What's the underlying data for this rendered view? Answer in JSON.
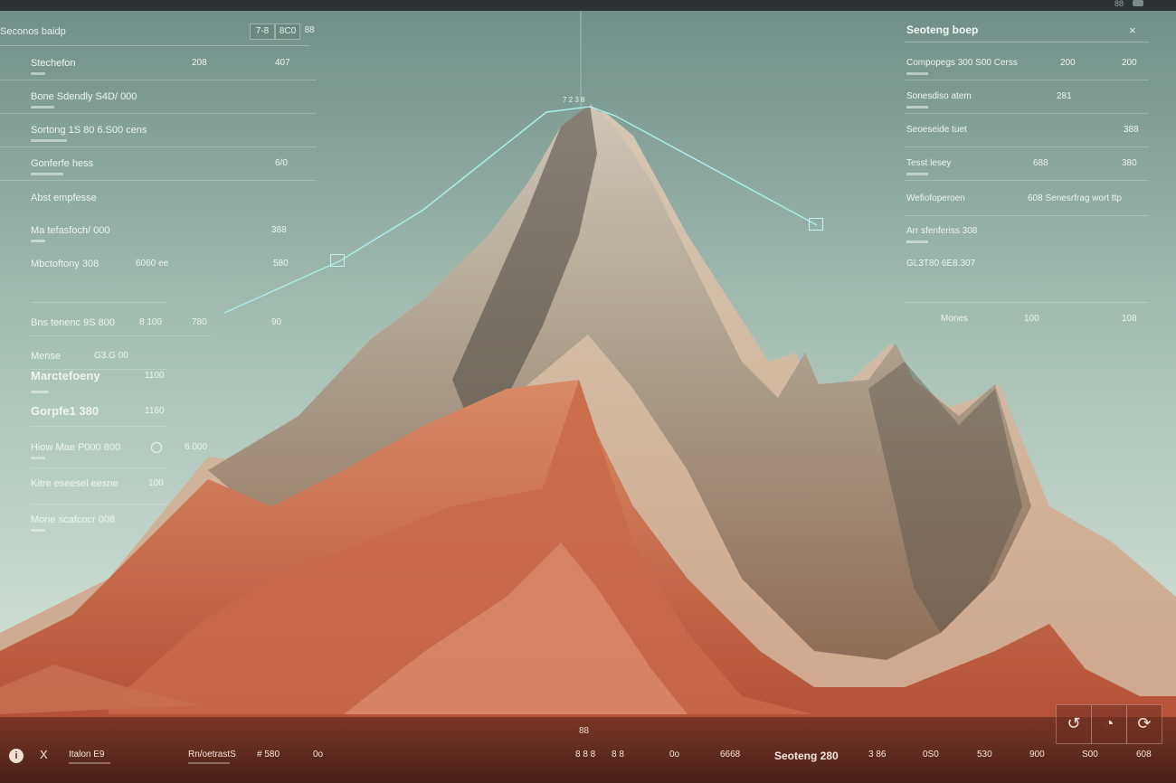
{
  "topbar": {
    "label": "88"
  },
  "left_panel": {
    "title": "Seconos baidp",
    "controls": [
      "7-8",
      "8C0",
      "88"
    ],
    "rows": [
      {
        "label": "Stechefon",
        "v1": "208",
        "v2": "407"
      },
      {
        "label": "Bone Sdendly S4D/ 000",
        "v1": "",
        "v2": ""
      },
      {
        "label": "Sortong 1S 80 6.S00 cens",
        "v1": "",
        "v2": ""
      },
      {
        "label": "Gonferfe hess",
        "v1": "",
        "v2": "6/0"
      },
      {
        "label": "Abst empfesse",
        "v1": "",
        "v2": ""
      },
      {
        "label": "Ma tefasfoch/ 000",
        "v1": "",
        "v2": "388"
      },
      {
        "label": "Mbctoftony 308",
        "v1": "6060 ee",
        "v2": "580"
      },
      {
        "label": "Bns tenenc 9S 800",
        "v1": "8 100",
        "v2": "780",
        "v3": "90"
      },
      {
        "label": "Mense",
        "v1": "G3.G 00",
        "v2": "",
        "v3": ""
      },
      {
        "label": "Marctefoeny",
        "v1": "1100",
        "v2": "",
        "v3": ""
      },
      {
        "label": "Gorpfe1 380",
        "v1": "1160",
        "v2": "",
        "v3": ""
      },
      {
        "label": "Hiow Mae P000 800",
        "v1": "",
        "v2": "6.000",
        "v3": ""
      },
      {
        "label": "Kitre eseesel eesne",
        "v1": "100",
        "v2": "",
        "v3": ""
      },
      {
        "label": "Mone scafcocr 008",
        "v1": "",
        "v2": "",
        "v3": ""
      }
    ]
  },
  "right_panel": {
    "title": "Seoteng boep",
    "close": "×",
    "rows": [
      {
        "label": "Compopegs 300 S00 Cerss",
        "v1": "200",
        "v2": "200"
      },
      {
        "label": "Sonesdiso atem",
        "v1": "281",
        "v2": ""
      },
      {
        "label": "Seoeseide tuet",
        "v1": "",
        "v2": "388"
      },
      {
        "label": "Tesst lesey",
        "v1": "688",
        "v2": "380"
      },
      {
        "label": "Wefiofoperoen",
        "v1": "608 Senesrfrag wort ttp",
        "v2": ""
      },
      {
        "label": "Arr sfenferiss 308",
        "v1": "",
        "v2": ""
      },
      {
        "label": "GL3T80 6E8.307",
        "v1": "",
        "v2": ""
      },
      {
        "label": "Mones",
        "v1": "100",
        "v2": "108"
      }
    ]
  },
  "graph": {
    "top_label": "7 2 3 8"
  },
  "bottom_bar": {
    "center_label": "88",
    "info": "i",
    "x": "X",
    "items": [
      {
        "label": "Italon E9"
      },
      {
        "label": "Rn/oetrastS"
      },
      {
        "label": "# 580"
      },
      {
        "label": "0o"
      },
      {
        "label": "8 8 8"
      },
      {
        "label": "8 8"
      },
      {
        "label": "0o"
      },
      {
        "label": "6668"
      },
      {
        "label": "Seoteng 280"
      },
      {
        "label": "3 86"
      },
      {
        "label": "0S0"
      },
      {
        "label": "530"
      },
      {
        "label": "900"
      },
      {
        "label": "S00"
      },
      {
        "label": "608"
      }
    ],
    "tools": [
      "↺",
      "◔",
      "⟳"
    ]
  },
  "colors": {
    "accent_line": "#a9ece9",
    "terrain_dark": "#b55a3d",
    "terrain_light": "#d8cbb6",
    "sky_top": "#7e9a93",
    "sky_bottom": "#d9e7dd"
  }
}
